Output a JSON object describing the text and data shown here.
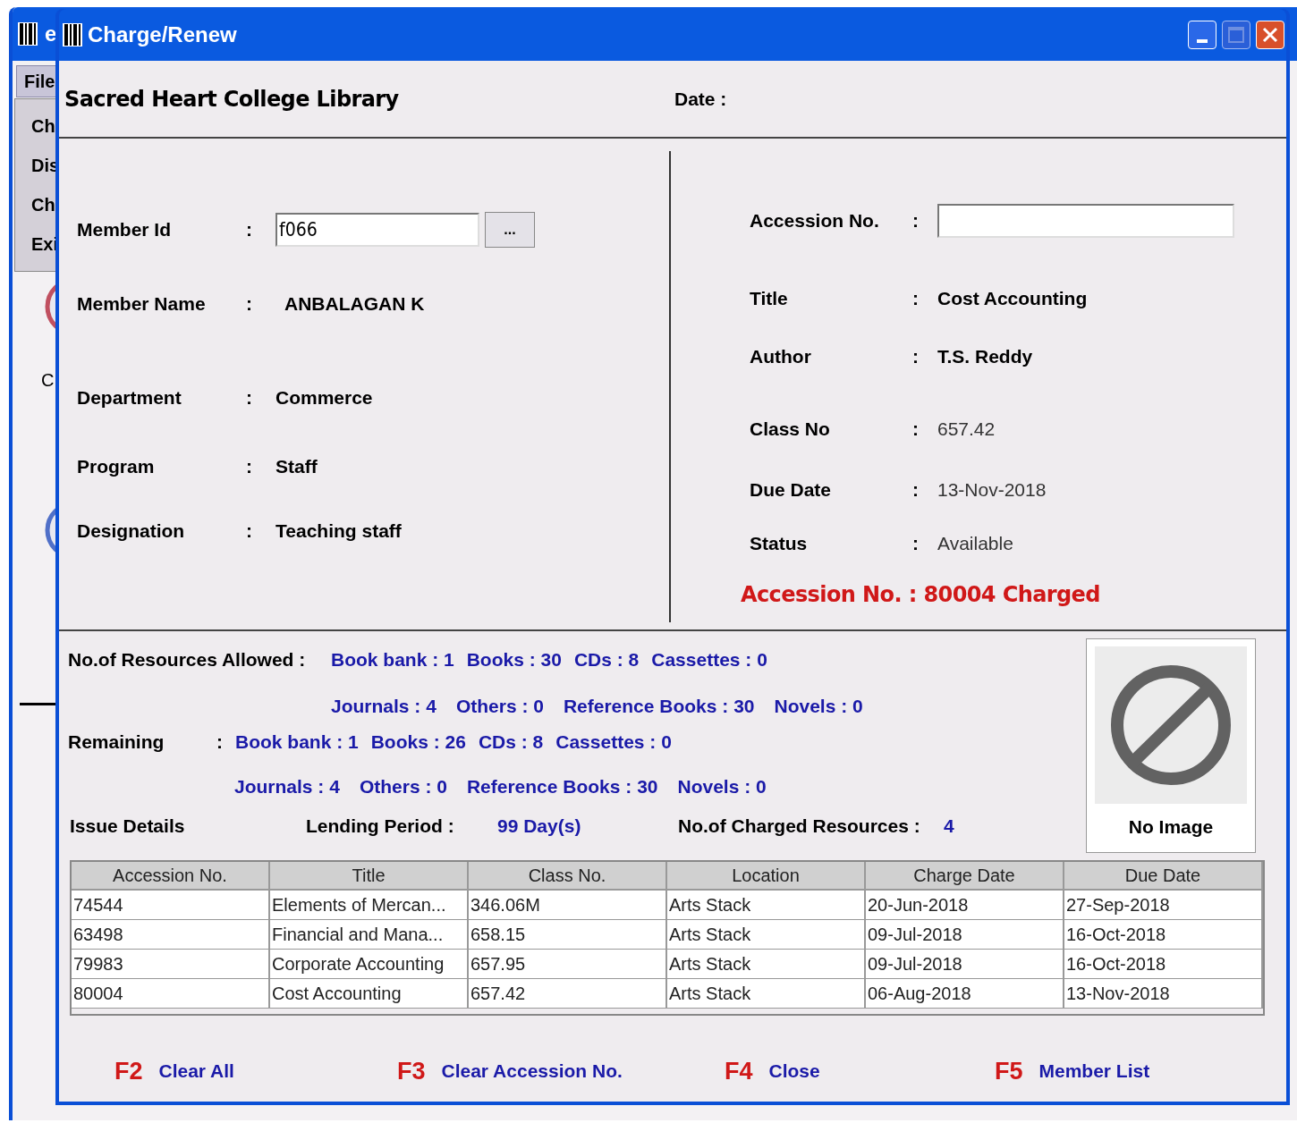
{
  "background_window": {
    "title": "e",
    "menu": [
      "File"
    ],
    "menu_items": [
      "Ch",
      "Dis",
      "Ch",
      "Exi"
    ],
    "label": "C"
  },
  "window": {
    "title": "Charge/Renew"
  },
  "header": {
    "library": "Sacred Heart College Library",
    "date_label": "Date :"
  },
  "member_fields": [
    {
      "kind": "input",
      "label": "Member Id",
      "separator": ":",
      "value": "f066",
      "button": "..."
    },
    {
      "kind": "text",
      "label": "Member Name",
      "separator": ":",
      "value": "ANBALAGAN  K",
      "bold": true
    },
    {
      "kind": "text",
      "label": "Department",
      "separator": ":",
      "value": "Commerce",
      "bold": true
    },
    {
      "kind": "text",
      "label": "Program",
      "separator": ":",
      "value": "Staff",
      "bold": true
    },
    {
      "kind": "text",
      "label": "Designation",
      "separator": ":",
      "value": "Teaching staff",
      "bold": true
    }
  ],
  "item_fields": [
    {
      "kind": "input",
      "label": "Accession No.",
      "separator": ":"
    },
    {
      "kind": "text",
      "label": "Title",
      "separator": ":",
      "value": "Cost Accounting",
      "bold": true
    },
    {
      "kind": "text",
      "label": "Author",
      "separator": ":",
      "value": "T.S. Reddy",
      "bold": true
    },
    {
      "kind": "text",
      "label": "Class No",
      "separator": ":",
      "value": "657.42",
      "bold": false
    },
    {
      "kind": "text",
      "label": "Due Date",
      "separator": ":",
      "value": "13-Nov-2018",
      "bold": false
    },
    {
      "kind": "text",
      "label": "Status",
      "separator": ":",
      "value": "Available",
      "bold": false
    }
  ],
  "item_message": "Accession No. : 80004 Charged",
  "allowed": {
    "label": "No.of Resources Allowed :",
    "lines": [
      [
        "Book bank : 1",
        "Books : 30",
        "CDs : 8",
        "Cassettes : 0"
      ],
      [
        "Journals : 4",
        "Others : 0",
        "Reference Books : 30",
        "Novels : 0"
      ]
    ]
  },
  "remaining": {
    "label": "Remaining",
    "separator": ":",
    "lines": [
      [
        "Book bank : 1",
        "Books : 26",
        "CDs : 8",
        "Cassettes : 0"
      ],
      [
        "Journals : 4",
        "Others : 0",
        "Reference Books : 30",
        "Novels : 0"
      ]
    ]
  },
  "issue": {
    "label": "Issue Details",
    "lending_label": "Lending Period :",
    "lending_value": "99 Day(s)",
    "charged_label": "No.of Charged Resources :",
    "charged_value": "4"
  },
  "image": {
    "caption": "No Image"
  },
  "table": {
    "columns": [
      "Accession No.",
      "Title",
      "Class No.",
      "Location",
      "Charge Date",
      "Due Date"
    ],
    "rows": [
      [
        "74544",
        "Elements of Mercan...",
        "346.06M",
        "Arts Stack",
        "20-Jun-2018",
        "27-Sep-2018"
      ],
      [
        "63498",
        "Financial and Mana...",
        "658.15",
        "Arts Stack",
        "09-Jul-2018",
        "16-Oct-2018"
      ],
      [
        "79983",
        "Corporate Accounting",
        "657.95",
        "Arts Stack",
        "09-Jul-2018",
        "16-Oct-2018"
      ],
      [
        "80004",
        "Cost Accounting",
        "657.42",
        "Arts Stack",
        "06-Aug-2018",
        "13-Nov-2018"
      ]
    ]
  },
  "shortcuts": [
    {
      "key": "F2",
      "label": "Clear All"
    },
    {
      "key": "F3",
      "label": "Clear Accession No."
    },
    {
      "key": "F4",
      "label": "Close"
    },
    {
      "key": "F5",
      "label": "Member List"
    }
  ]
}
